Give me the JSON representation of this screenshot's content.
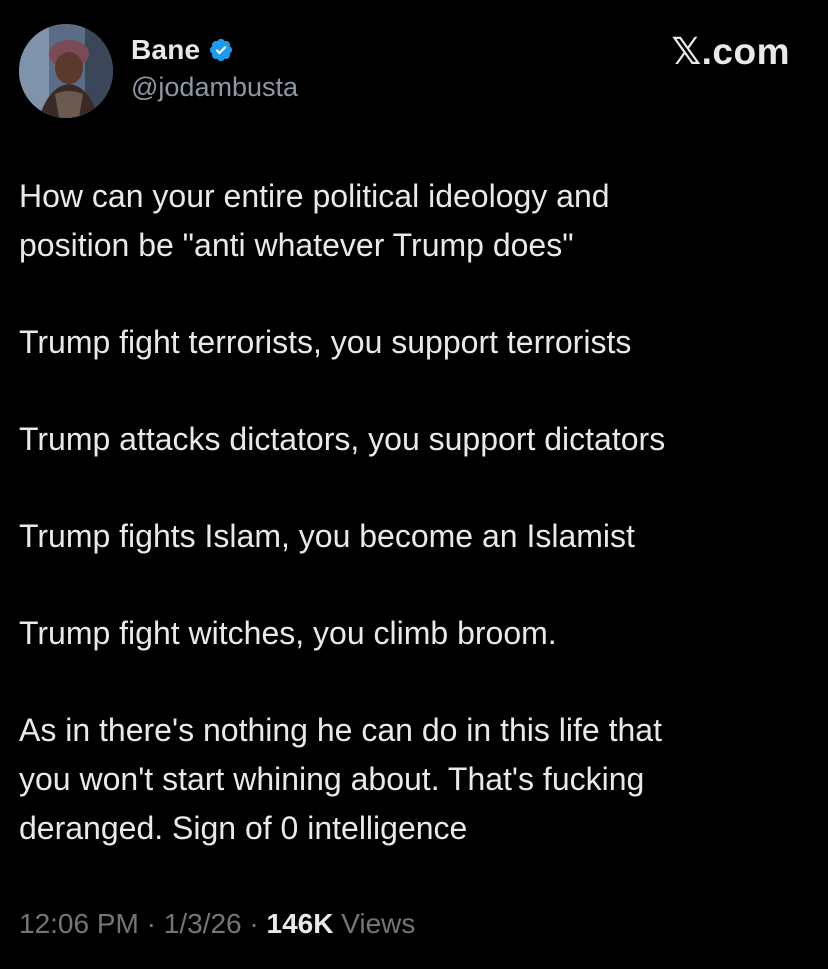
{
  "author": {
    "display_name": "Bane",
    "handle": "@jodambusta",
    "verified": true
  },
  "brand": "𝕏.com",
  "tweet": {
    "paragraphs": [
      "How can your entire political ideology and\nposition be \"anti whatever Trump does\"",
      "Trump fight terrorists, you support terrorists",
      "Trump attacks dictators, you support dictators",
      "Trump fights Islam, you become an Islamist",
      "Trump fight witches, you climb broom.",
      "As in there's nothing he can do in this life that\nyou won't start whining about. That's fucking\nderanged. Sign of 0 intelligence"
    ]
  },
  "meta": {
    "time": "12:06 PM",
    "sep1": " · ",
    "date": "1/3/26",
    "sep2": " · ",
    "views_count": "146K",
    "views_label": " Views"
  },
  "colors": {
    "background": "#000000",
    "text": "#e7e9ea",
    "secondary": "#71767b",
    "verified_badge": "#1d9bf0"
  }
}
